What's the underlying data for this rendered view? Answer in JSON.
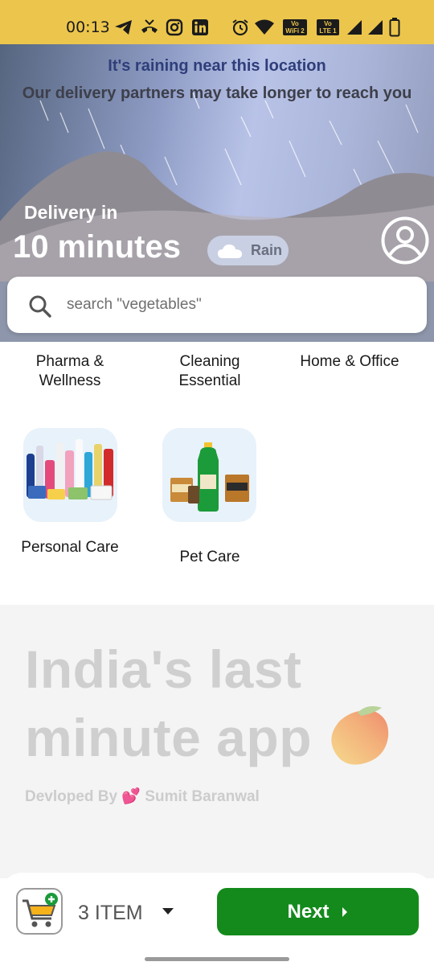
{
  "status_bar": {
    "time": "00:13",
    "icons": [
      "telegram-icon",
      "missed-call-icon",
      "instagram-icon",
      "linkedin-icon",
      "alarm-icon",
      "wifi-icon",
      "volte-wifi2-icon",
      "volte-lte1-icon",
      "signal-icon",
      "signal-icon",
      "battery-icon"
    ],
    "tag_vowifi": "Vo WiFi 2",
    "tag_lte": "Vo LTE 1"
  },
  "hero": {
    "rain_title": "It's raining near this location",
    "rain_subtitle": "Our delivery partners may take longer to reach you",
    "delivery_label": "Delivery in",
    "delivery_time": "10 minutes",
    "weather_label": "Rain",
    "weather_icon": "cloud-icon",
    "profile_icon": "profile-icon"
  },
  "search": {
    "placeholder": "search \"vegetables\"",
    "icon": "search-icon"
  },
  "categories_top": [
    {
      "label": "Pharma & Wellness"
    },
    {
      "label": "Cleaning Essential"
    },
    {
      "label": "Home & Office"
    }
  ],
  "categories_bottom": [
    {
      "label": "Personal Care"
    },
    {
      "label": "Pet Care"
    }
  ],
  "tagline": {
    "line1": "India's last",
    "line2": "minute app",
    "credit": "Devloped By 💕 Sumit Baranwal"
  },
  "cart": {
    "count_label": "3 ITEM",
    "next_label": "Next"
  },
  "colors": {
    "status_bar": "#ecc64c",
    "next_button": "#148a1c",
    "tagline": "#cfcfcf"
  }
}
